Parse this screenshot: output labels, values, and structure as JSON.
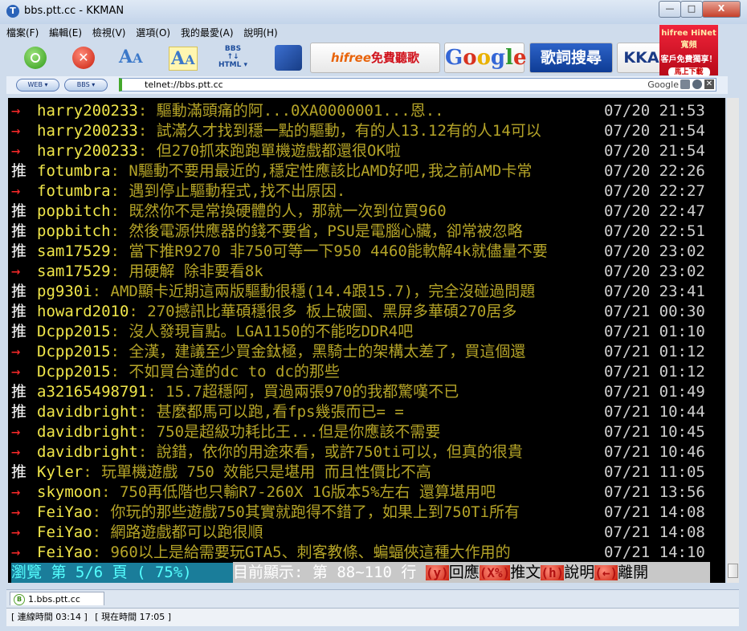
{
  "window": {
    "title": "bbs.ptt.cc - KKMAN",
    "min": "—",
    "max": "□",
    "close": "X"
  },
  "menu": [
    "檔案(F)",
    "編輯(E)",
    "檢視(V)",
    "選項(O)",
    "我的最愛(A)",
    "說明(H)"
  ],
  "toolbar": {
    "bbs_icon_label": "BBS\n↑↓\nHTML",
    "ad_hifree_brand": "hifree",
    "ad_hifree_text": "免費聽歌",
    "ad_google": "Google",
    "ad_lyric": "歌詞搜尋",
    "ad_kk": "KKA"
  },
  "promo": {
    "line1": "hifree HiNet寬頻",
    "line2": "客戶免費獨享！",
    "line3": "馬上下載"
  },
  "address": {
    "web_label": "WEB ▾",
    "bbs_label": "BBS ▾",
    "url": "telnet://bbs.ptt.cc",
    "search_engine": "Google"
  },
  "terminal": {
    "rows": [
      {
        "tag": "→",
        "type": "arrow",
        "user": "harry200233",
        "text": ": 驅動滿頭痛的阿...0XA0000001...恩..",
        "datetime": "07/20 21:53"
      },
      {
        "tag": "→",
        "type": "arrow",
        "user": "harry200233",
        "text": ": 試滿久才找到穩一點的驅動，有的人13.12有的人14可以",
        "datetime": "07/20 21:54"
      },
      {
        "tag": "→",
        "type": "arrow",
        "user": "harry200233",
        "text": ": 但270抓來跑跑單機遊戲都還很OK啦",
        "datetime": "07/20 21:54"
      },
      {
        "tag": "推",
        "type": "push",
        "user": "fotumbra",
        "text": ": N驅動不要用最近的,穩定性應該比AMD好吧,我之前AMD卡常",
        "datetime": "07/20 22:26"
      },
      {
        "tag": "→",
        "type": "arrow",
        "user": "fotumbra",
        "text": ": 遇到停止驅動程式,找不出原因.",
        "datetime": "07/20 22:27"
      },
      {
        "tag": "推",
        "type": "push",
        "user": "popbitch",
        "text": ": 既然你不是常換硬體的人，那就一次到位買960",
        "datetime": "07/20 22:47"
      },
      {
        "tag": "推",
        "type": "push",
        "user": "popbitch",
        "text": ": 然後電源供應器的錢不要省，PSU是電腦心臟，卻常被忽略",
        "datetime": "07/20 22:51"
      },
      {
        "tag": "推",
        "type": "push",
        "user": "sam17529",
        "text": ": 當下推R9270 非750可等一下950 4460能軟解4k就儘量不要",
        "datetime": "07/20 23:02"
      },
      {
        "tag": "→",
        "type": "arrow",
        "user": "sam17529",
        "text": ": 用硬解 除非要看8k",
        "datetime": "07/20 23:02"
      },
      {
        "tag": "推",
        "type": "push",
        "user": "pg930i",
        "text": ": AMD顯卡近期這兩版驅動很穩(14.4跟15.7)，完全沒碰過問題",
        "datetime": "07/20 23:41"
      },
      {
        "tag": "推",
        "type": "push",
        "user": "howard2010",
        "text": ": 270撼訊比華碩穩很多 板上破圖、黑屏多華碩270居多",
        "datetime": "07/21 00:30"
      },
      {
        "tag": "推",
        "type": "push",
        "user": "Dcpp2015",
        "text": ": 沒人發現盲點。LGA1150的不能吃DDR4吧",
        "datetime": "07/21 01:10"
      },
      {
        "tag": "→",
        "type": "arrow",
        "user": "Dcpp2015",
        "text": ": 全漢，建議至少買金鈦極，黑騎士的架構太差了，買這個還",
        "datetime": "07/21 01:12"
      },
      {
        "tag": "→",
        "type": "arrow",
        "user": "Dcpp2015",
        "text": ": 不如買台達的dc to dc的那些",
        "datetime": "07/21 01:12"
      },
      {
        "tag": "推",
        "type": "push",
        "user": "a32165498791",
        "text": ": 15.7超穩阿，買過兩張970的我都驚嘆不已",
        "datetime": "07/21 01:49"
      },
      {
        "tag": "推",
        "type": "push",
        "user": "davidbright",
        "text": ": 甚麼都馬可以跑,看fps幾張而已= =",
        "datetime": "07/21 10:44"
      },
      {
        "tag": "→",
        "type": "arrow",
        "user": "davidbright",
        "text": ": 750是超級功耗比王...但是你應該不需要",
        "datetime": "07/21 10:45"
      },
      {
        "tag": "→",
        "type": "arrow",
        "user": "davidbright",
        "text": ": 說錯，依你的用途來看，或許750ti可以，但真的很貴",
        "datetime": "07/21 10:46"
      },
      {
        "tag": "推",
        "type": "push",
        "user": "Kyler",
        "text": ": 玩單機遊戲 750 效能只是堪用 而且性價比不高",
        "datetime": "07/21 11:05"
      },
      {
        "tag": "→",
        "type": "arrow",
        "user": "skymoon",
        "text": ": 750再低階也只輸R7-260X 1G版本5%左右 還算堪用吧",
        "datetime": "07/21 13:56"
      },
      {
        "tag": "→",
        "type": "arrow",
        "user": "FeiYao",
        "text": ": 你玩的那些遊戲750其實就跑得不錯了，如果上到750Ti所有",
        "datetime": "07/21 14:08"
      },
      {
        "tag": "→",
        "type": "arrow",
        "user": "FeiYao",
        "text": ": 網路遊戲都可以跑很順",
        "datetime": "07/21 14:08"
      },
      {
        "tag": "→",
        "type": "arrow",
        "user": "FeiYao",
        "text": ": 960以上是給需要玩GTA5、刺客教條、蝙蝠俠這種大作用的",
        "datetime": "07/21 14:10"
      }
    ],
    "status": {
      "browse": "  瀏覽 第 5/6 頁 ( 75%)",
      "range": " 目前顯示: 第 88~110 行 ",
      "k1": "(y)",
      "a1": "回應",
      "k2": "(X%)",
      "a2": "推文",
      "k3": "(h)",
      "a3": "說明",
      "k4": "(←)",
      "a4": "離開"
    }
  },
  "tabs": [
    {
      "label": "1.bbs.ptt.cc"
    }
  ],
  "statusbar": {
    "connect": "[ 連線時間 03:14 ]",
    "now": "[ 現在時間 17:05 ]"
  }
}
